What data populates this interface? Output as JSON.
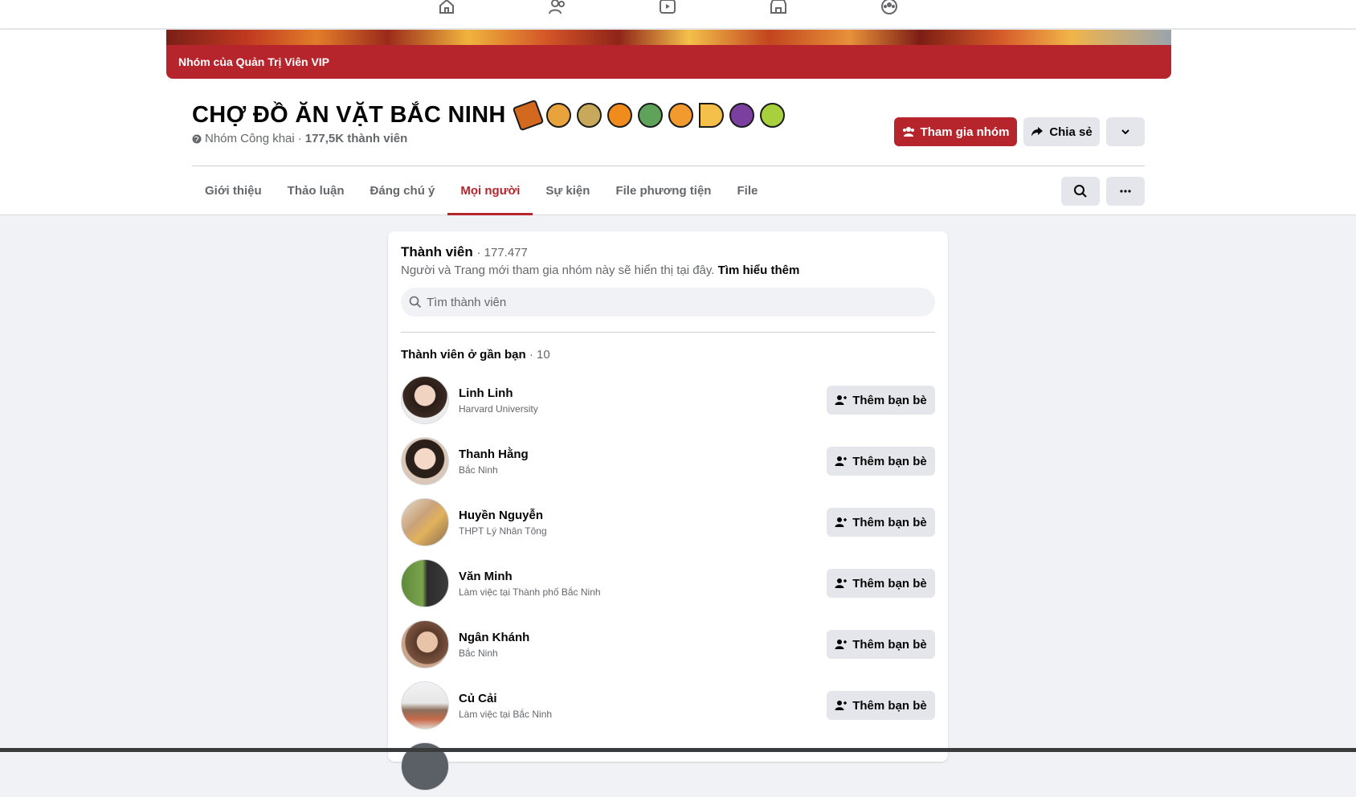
{
  "topnav": {
    "icons": [
      "home-icon",
      "friends-icon",
      "watch-icon",
      "marketplace-icon",
      "groups-icon"
    ]
  },
  "group": {
    "badge": "Nhóm của Quản Trị Viên VIP",
    "title": "CHỢ ĐỒ ĂN VẶT BẮC NINH",
    "privacy": "Nhóm Công khai",
    "separator": "·",
    "members_short": "177,5K thành viên",
    "join_label": "Tham gia nhóm",
    "share_label": "Chia sẻ"
  },
  "tabs": [
    {
      "label": "Giới thiệu",
      "active": false
    },
    {
      "label": "Thảo luận",
      "active": false
    },
    {
      "label": "Đáng chú ý",
      "active": false
    },
    {
      "label": "Mọi người",
      "active": true
    },
    {
      "label": "Sự kiện",
      "active": false
    },
    {
      "label": "File phương tiện",
      "active": false
    },
    {
      "label": "File",
      "active": false
    }
  ],
  "members_card": {
    "title": "Thành viên",
    "count": "· 177.477",
    "subtitle": "Người và Trang mới tham gia nhóm này sẽ hiển thị tại đây.",
    "learn_more": "Tìm hiểu thêm",
    "search_placeholder": "Tìm thành viên",
    "nearby_title": "Thành viên ở gần bạn",
    "nearby_count": "· 10",
    "add_friend_label": "Thêm bạn bè",
    "members": [
      {
        "name": "Linh Linh",
        "sub": "Harvard University"
      },
      {
        "name": "Thanh Hằng",
        "sub": "Bắc Ninh"
      },
      {
        "name": "Huyền Nguyễn",
        "sub": "THPT Lý Nhân Tông"
      },
      {
        "name": "Văn Minh",
        "sub": "Làm việc tại Thành phố Bắc Ninh"
      },
      {
        "name": "Ngân Khánh",
        "sub": "Bắc Ninh"
      },
      {
        "name": "Củ Cải",
        "sub": "Làm việc tại Bắc Ninh"
      }
    ]
  },
  "colors": {
    "accent": "#b7252c",
    "background": "#f0f2f5",
    "button_gray": "#e4e6eb",
    "secondary_text": "#65676b"
  }
}
